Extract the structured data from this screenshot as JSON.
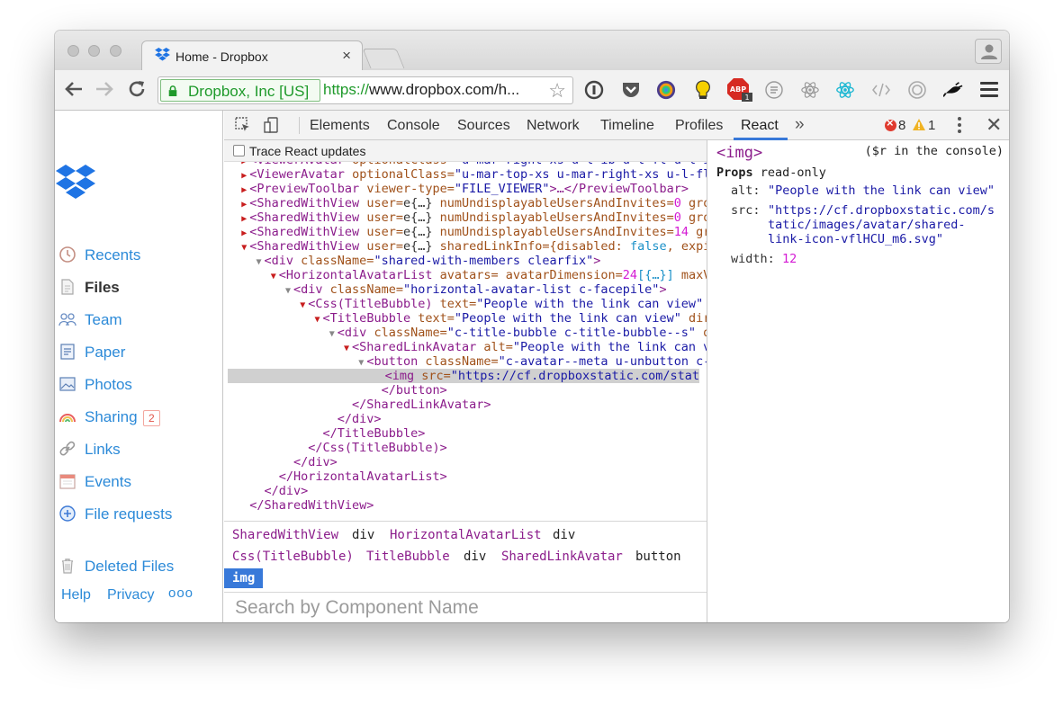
{
  "browser": {
    "tab_title": "Home - Dropbox",
    "tab_close": "×",
    "ev_name": "Dropbox, Inc [US]",
    "url_scheme": "https://",
    "url_rest": "www.dropbox.com/h..."
  },
  "sidebar": {
    "items": [
      {
        "label": "Recents"
      },
      {
        "label": "Files"
      },
      {
        "label": "Team"
      },
      {
        "label": "Paper"
      },
      {
        "label": "Photos"
      },
      {
        "label": "Sharing",
        "badge": "2"
      },
      {
        "label": "Links"
      },
      {
        "label": "Events"
      },
      {
        "label": "File requests"
      }
    ],
    "deleted": "Deleted Files",
    "help": "Help",
    "privacy": "Privacy",
    "more": "ooo"
  },
  "devtools": {
    "tabs": [
      "Elements",
      "Console",
      "Sources",
      "Network",
      "Timeline",
      "Profiles",
      "React"
    ],
    "more_tabs": "»",
    "errors": "8",
    "warnings": "1",
    "close": "✕",
    "trace_label": "Trace React updates",
    "tree": [
      {
        "p": "  ",
        "a": "▶",
        "t": "<ViewerAvatar",
        "at": " optionalClass=",
        "s": "\"u-mar-right-xs u-l-ib u-l-fl u-l-ib\""
      },
      {
        "p": "  ",
        "a": "▶",
        "t": "<ViewerAvatar",
        "at": " optionalClass=",
        "s": "\"u-mar-top-xs u-mar-right-xs u-l-fl"
      },
      {
        "p": "  ",
        "a": "▶",
        "t": "<PreviewToolbar",
        "at": " viewer-type=",
        "s": "\"FILE_VIEWER\"",
        "t2": ">…</PreviewToolbar>"
      },
      {
        "p": "  ",
        "a": "▶",
        "t": "<SharedWithView",
        "at": " user=",
        "x": "e{…}",
        "at2": " numUndisplayableUsersAndInvites=",
        "n": "0",
        "at3": " gro"
      },
      {
        "p": "  ",
        "a": "▶",
        "t": "<SharedWithView",
        "at": " user=",
        "x": "e{…}",
        "at2": " numUndisplayableUsersAndInvites=",
        "n": "0",
        "at3": " gro"
      },
      {
        "p": "  ",
        "a": "▶",
        "t": "<SharedWithView",
        "at": " user=",
        "x": "e{…}",
        "at2": " numUndisplayableUsersAndInvites=",
        "n": "14",
        "at3": " gr"
      },
      {
        "p": "  ",
        "a": "▼",
        "t": "<SharedWithView",
        "at": " user=",
        "x": "e{…}",
        "at2": " sharedLinkInfo=",
        "x2": "{disabled: ",
        "b": "false",
        "at3": ", expi"
      },
      {
        "p": "    ",
        "a": "▼",
        "g": true,
        "t": "<div",
        "at": " className=",
        "s": "\"shared-with-members clearfix\"",
        "t2": ">"
      },
      {
        "p": "      ",
        "a": "▼",
        "t": "<HorizontalAvatarList",
        "at": " avatars=",
        "b": "[{…}]",
        "at2": " avatarDimension=",
        "n": "24",
        "at3": " maxVi"
      },
      {
        "p": "        ",
        "a": "▼",
        "g": true,
        "t": "<div",
        "at": " className=",
        "s": "\"horizontal-avatar-list c-facepile\"",
        "t2": ">"
      },
      {
        "p": "          ",
        "a": "▼",
        "t": "<Css(TitleBubble)",
        "at": " text=",
        "s": "\"People with the link can view\"",
        "at2": " di"
      },
      {
        "p": "            ",
        "a": "▼",
        "t": "<TitleBubble",
        "at": " text=",
        "s": "\"People with the link can view\"",
        "at2": " direct"
      },
      {
        "p": "              ",
        "a": "▼",
        "g": true,
        "t": "<div",
        "at": " className=",
        "s": "\"c-title-bubble c-title-bubble--s\"",
        "at2": " data"
      },
      {
        "p": "                ",
        "a": "▼",
        "t": "<SharedLinkAvatar",
        "at": " alt=",
        "s": "\"People with the link can view"
      },
      {
        "p": "                  ",
        "a": "▼",
        "g": true,
        "t": "<button",
        "at": " className=",
        "s": "\"c-avatar--meta u-unbutton c-avat"
      },
      {
        "p": "                    ",
        "a": " ",
        "t": "<img",
        "at": " src=",
        "s": "\"https://cf.dropboxstatic.com/static/ima",
        "sel": true
      },
      {
        "p": "                    ",
        "a": " ",
        "t": "</button>"
      },
      {
        "p": "                ",
        "a": " ",
        "t": "</SharedLinkAvatar>"
      },
      {
        "p": "              ",
        "a": " ",
        "t": "</div>"
      },
      {
        "p": "            ",
        "a": " ",
        "t": "</TitleBubble>"
      },
      {
        "p": "          ",
        "a": " ",
        "t": "</Css(TitleBubble)>"
      },
      {
        "p": "        ",
        "a": " ",
        "t": "</div>"
      },
      {
        "p": "      ",
        "a": " ",
        "t": "</HorizontalAvatarList>"
      },
      {
        "p": "    ",
        "a": " ",
        "t": "</div>"
      },
      {
        "p": "  ",
        "a": " ",
        "t": "</SharedWithView>"
      }
    ],
    "breadcrumbs": {
      "row1": [
        {
          "label": "SharedWithView",
          "kind": "comp"
        },
        {
          "label": "div",
          "kind": "dom"
        },
        {
          "label": "HorizontalAvatarList",
          "kind": "comp"
        },
        {
          "label": "div",
          "kind": "dom"
        }
      ],
      "row2": [
        {
          "label": "Css(TitleBubble)",
          "kind": "comp"
        },
        {
          "label": "TitleBubble",
          "kind": "comp"
        },
        {
          "label": "div",
          "kind": "dom"
        },
        {
          "label": "SharedLinkAvatar",
          "kind": "comp"
        },
        {
          "label": "button",
          "kind": "dom"
        }
      ],
      "selected": "img"
    },
    "search_placeholder": "Search by Component Name",
    "props": {
      "tag": "<img>",
      "console_hint": "($r in the console)",
      "heading": "Props",
      "readonly": " read-only",
      "alt_key": "alt:",
      "alt_val": "\"People with the link can view\"",
      "src_key": "src:",
      "src_val_1": "\"https://cf.dropboxstatic.com/s",
      "src_val_2": "tatic/images/avatar/shared-",
      "src_val_3": "link-icon-vflHCU_m6.svg\"",
      "width_key": "width:",
      "width_val": "12"
    }
  }
}
